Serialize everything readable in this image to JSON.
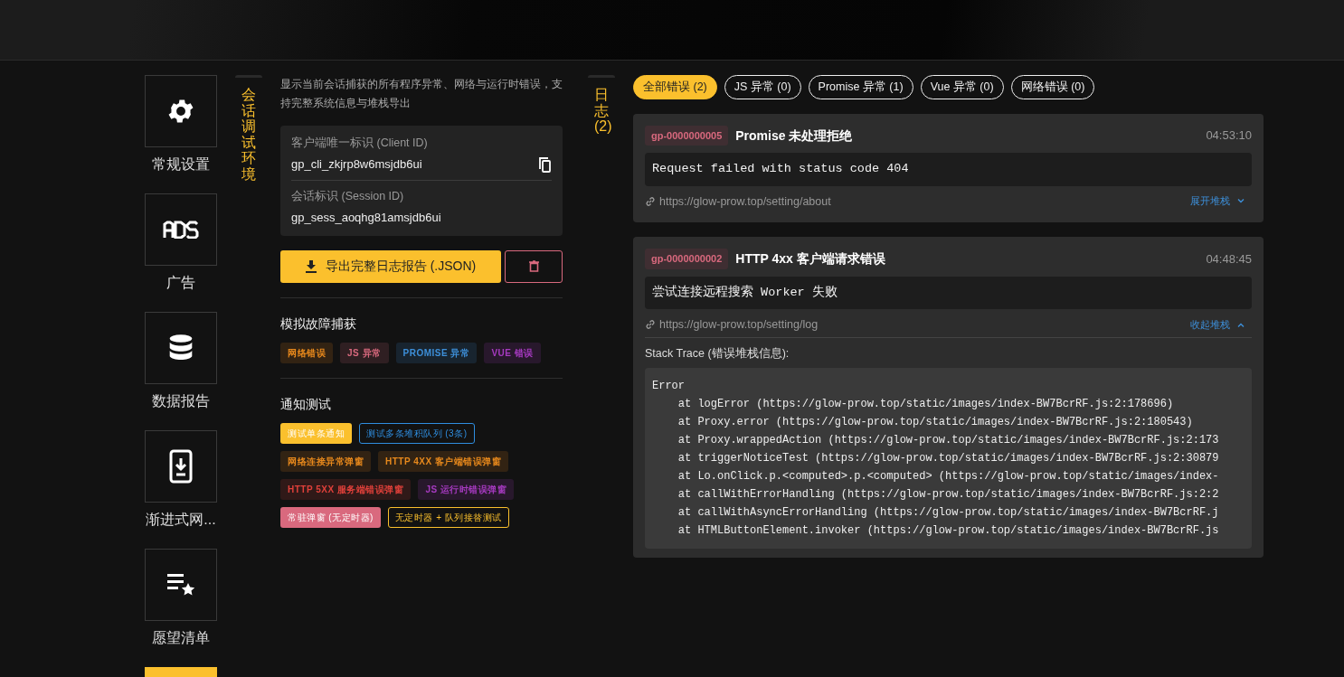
{
  "sidebar": {
    "items": [
      {
        "label": "常规设置",
        "selected": false
      },
      {
        "label": "广告",
        "selected": false
      },
      {
        "label": "数据报告",
        "selected": false
      },
      {
        "label": "渐进式网...",
        "selected": false
      },
      {
        "label": "愿望清单",
        "selected": false
      },
      {
        "selected": true
      }
    ]
  },
  "session_tab": {
    "label": "会话调试环境"
  },
  "session": {
    "description": "显示当前会话捕获的所有程序异常、网络与运行时错误，支持完整系统信息与堆栈导出",
    "fields": [
      {
        "label": "客户端唯一标识 (Client ID)",
        "value": "gp_cli_zkjrp8w6msjdb6ui"
      },
      {
        "label": "会话标识 (Session ID)",
        "value": "gp_sess_aoqhg81amsjdb6ui"
      }
    ],
    "export_button": "导出完整日志报告 (.JSON)",
    "fault_title": "模拟故障捕获",
    "fault_tags": [
      {
        "label": "网络错误",
        "color": "#e8891c"
      },
      {
        "label": "JS 异常",
        "color": "#d9697e"
      },
      {
        "label": "PROMISE 异常",
        "color": "#3d8fd9"
      },
      {
        "label": "VUE 错误",
        "color": "#a63ac0"
      }
    ],
    "notice_title": "通知测试",
    "notice_buttons": [
      {
        "label": "测试单条通知",
        "kind": "solid",
        "color": "#fbc02d"
      },
      {
        "label": "测试多条堆积队列 (3条)",
        "kind": "outline",
        "color": "#2f8ee0"
      },
      {
        "label": "网络连接异常弹窗",
        "kind": "tint",
        "color": "#e8891c"
      },
      {
        "label": "HTTP 4XX 客户端错误弹窗",
        "kind": "tint",
        "color": "#e8891c"
      },
      {
        "label": "HTTP 5XX 服务端错误弹窗",
        "kind": "tint",
        "color": "#e0403a"
      },
      {
        "label": "JS 运行时错误弹窗",
        "kind": "tint",
        "color": "#a63ac0"
      },
      {
        "label": "常驻弹窗 (无定时器)",
        "kind": "solid",
        "color": "#d9697e"
      },
      {
        "label": "无定时器 + 队列接替测试",
        "kind": "outline",
        "color": "#fbc02d"
      }
    ]
  },
  "log_tab": {
    "label": "日志 (2)"
  },
  "filters": [
    {
      "label": "全部错误 (2)",
      "selected": true
    },
    {
      "label": "JS 异常 (0)",
      "selected": false
    },
    {
      "label": "Promise 异常 (1)",
      "selected": false
    },
    {
      "label": "Vue 异常 (0)",
      "selected": false
    },
    {
      "label": "网络错误 (0)",
      "selected": false
    }
  ],
  "logs": [
    {
      "id": "gp-0000000005",
      "title": "Promise 未处理拒绝",
      "time": "04:53:10",
      "message": "Request failed with status code 404",
      "url": "https://glow-prow.top/setting/about",
      "toggle": "展开堆栈",
      "expanded": false
    },
    {
      "id": "gp-0000000002",
      "title": "HTTP 4xx 客户端请求错误",
      "time": "04:48:45",
      "message": "尝试连接远程搜索 Worker 失败",
      "url": "https://glow-prow.top/setting/log",
      "toggle": "收起堆栈",
      "expanded": true,
      "stack_title": "Stack Trace (错误堆栈信息):",
      "stack": [
        "Error",
        "    at logError (https://glow-prow.top/static/images/index-BW7BcrRF.js:2:178696)",
        "    at Proxy.error (https://glow-prow.top/static/images/index-BW7BcrRF.js:2:180543)",
        "    at Proxy.wrappedAction (https://glow-prow.top/static/images/index-BW7BcrRF.js:2:173",
        "    at triggerNoticeTest (https://glow-prow.top/static/images/index-BW7BcrRF.js:2:30879",
        "    at Lo.onClick.p.<computed>.p.<computed> (https://glow-prow.top/static/images/index-",
        "    at callWithErrorHandling (https://glow-prow.top/static/images/index-BW7BcrRF.js:2:2",
        "    at callWithAsyncErrorHandling (https://glow-prow.top/static/images/index-BW7BcrRF.j",
        "    at HTMLButtonElement.invoker (https://glow-prow.top/static/images/index-BW7BcrRF.js"
      ]
    }
  ]
}
